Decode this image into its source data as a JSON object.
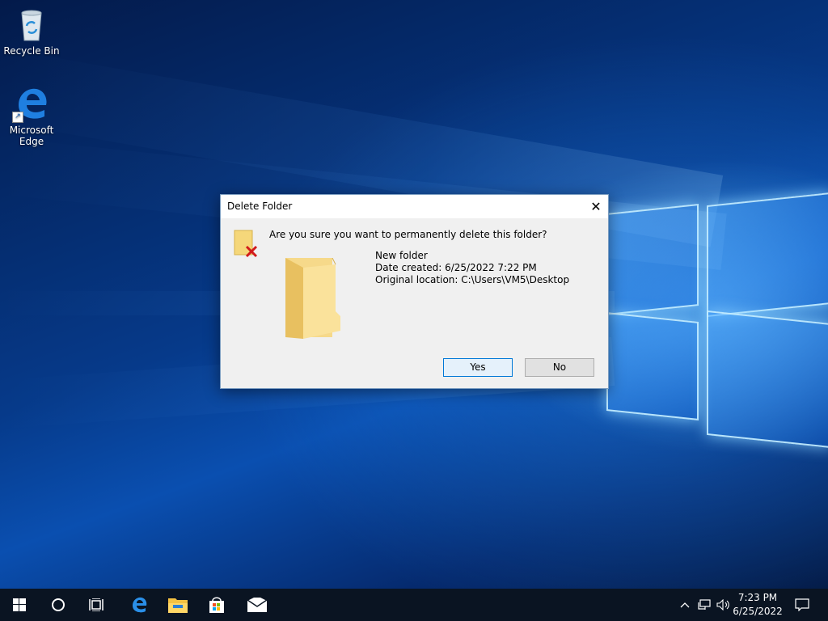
{
  "desktop": {
    "icons": [
      {
        "label": "Recycle Bin",
        "icon": "recycle-bin-icon"
      },
      {
        "label": "Microsoft\nEdge",
        "label_line1": "Microsoft",
        "label_line2": "Edge",
        "icon": "edge-icon"
      }
    ]
  },
  "dialog": {
    "title": "Delete Folder",
    "close_glyph": "✕",
    "question": "Are you sure you want to permanently delete this folder?",
    "item_name": "New folder",
    "date_created": "Date created: 6/25/2022 7:22 PM",
    "original_location": "Original location: C:\\Users\\VM5\\Desktop",
    "yes_label": "Yes",
    "no_label": "No"
  },
  "taskbar": {
    "items": [
      "start-icon",
      "search-icon",
      "task-view-icon",
      "edge-icon",
      "file-explorer-icon",
      "store-icon",
      "mail-icon"
    ],
    "tray": [
      "chevron-up-icon",
      "network-icon",
      "volume-icon"
    ],
    "time": "7:23 PM",
    "date": "6/25/2022",
    "notification_icon": "action-center-icon"
  },
  "colors": {
    "accent": "#0078d7",
    "taskbar": "#0a1422",
    "folder": "#f5d77a",
    "delete_x": "#d11a1a"
  }
}
